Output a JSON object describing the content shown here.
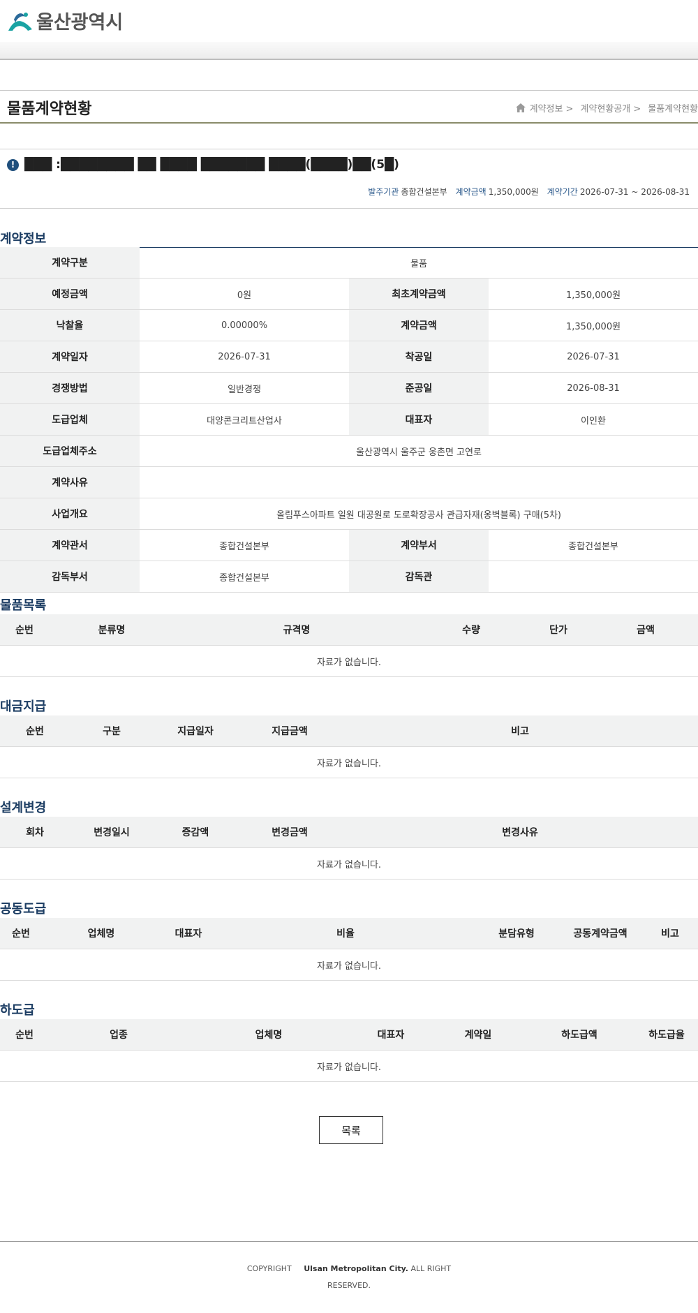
{
  "header": {
    "logo_text": "울산광역시"
  },
  "title": "물품계약현황",
  "breadcrumb": [
    "계약정보 >",
    "계약현황공개 >",
    "물품계약현황"
  ],
  "contract_title": "███ :████████ ██ ████ ███████ ████(████)██(5█)",
  "summary": {
    "agency_label": "발주기관",
    "agency": "종합건설본부",
    "amount_label": "계약금액",
    "amount": "1,350,000원",
    "period_label": "계약기간",
    "period": "2026-07-31 ~ 2026-08-31"
  },
  "info": {
    "title": "계약정보",
    "rows": [
      [
        {
          "th": "계약구분"
        },
        {
          "td": "물품",
          "wide": true
        }
      ],
      [
        {
          "th": "예정금액"
        },
        {
          "td": "0원"
        },
        {
          "th": "최초계약금액"
        },
        {
          "td": "1,350,000원"
        }
      ],
      [
        {
          "th": "낙찰율"
        },
        {
          "td": "0.00000%"
        },
        {
          "th": "계약금액"
        },
        {
          "td": "1,350,000원"
        }
      ],
      [
        {
          "th": "계약일자"
        },
        {
          "td": "2026-07-31"
        },
        {
          "th": "착공일"
        },
        {
          "td": "2026-07-31"
        }
      ],
      [
        {
          "th": "경쟁방법"
        },
        {
          "td": "일반경쟁"
        },
        {
          "th": "준공일"
        },
        {
          "td": "2026-08-31"
        }
      ],
      [
        {
          "th": "도급업체"
        },
        {
          "td": "대양콘크리트산업사"
        },
        {
          "th": "대표자"
        },
        {
          "td": "이인환"
        }
      ],
      [
        {
          "th": "도급업체주소"
        },
        {
          "td": "울산광역시 울주군 웅촌면 고연로",
          "wide": true
        }
      ],
      [
        {
          "th": "계약사유"
        },
        {
          "td": "",
          "wide": true
        }
      ],
      [
        {
          "th": "사업개요"
        },
        {
          "td": "올림푸스아파트 일원 대공원로 도로확장공사 관급자재(옹벽블록) 구매(5차)",
          "wide": true
        }
      ],
      [
        {
          "th": "계약관서"
        },
        {
          "td": "종합건설본부"
        },
        {
          "th": "계약부서"
        },
        {
          "td": "종합건설본부"
        }
      ],
      [
        {
          "th": "감독부서"
        },
        {
          "td": "종합건설본부"
        },
        {
          "th": "감독관"
        },
        {
          "td": ""
        }
      ]
    ]
  },
  "tables": [
    {
      "key": "items",
      "title": "물품목록",
      "columns": [
        "순번",
        "분류명",
        "규격명",
        "수량",
        "단가",
        "금액"
      ],
      "empty": "자료가 없습니다."
    },
    {
      "key": "payments",
      "title": "대금지급",
      "columns": [
        "순번",
        "구분",
        "지급일자",
        "지급금액",
        "비고"
      ],
      "empty": "자료가 없습니다."
    },
    {
      "key": "design_changes",
      "title": "설계변경",
      "columns": [
        "회차",
        "변경일시",
        "증감액",
        "변경금액",
        "변경사유"
      ],
      "empty": "자료가 없습니다."
    },
    {
      "key": "joint_contract",
      "title": "공동도급",
      "columns": [
        "순번",
        "업체명",
        "대표자",
        "비율",
        "분담유형",
        "공동계약금액",
        "비고"
      ],
      "empty": "자료가 없습니다."
    },
    {
      "key": "subcontract",
      "title": "하도급",
      "columns": [
        "순번",
        "업종",
        "업체명",
        "대표자",
        "계약일",
        "하도급액",
        "하도급율"
      ],
      "empty": "자료가 없습니다."
    }
  ],
  "list_button": "목록",
  "footer": {
    "line1_a": "COPYRIGHT",
    "line1_b": "Ulsan Metropolitan City.",
    "line1_c": "ALL RIGHT",
    "line2": "RESERVED."
  }
}
